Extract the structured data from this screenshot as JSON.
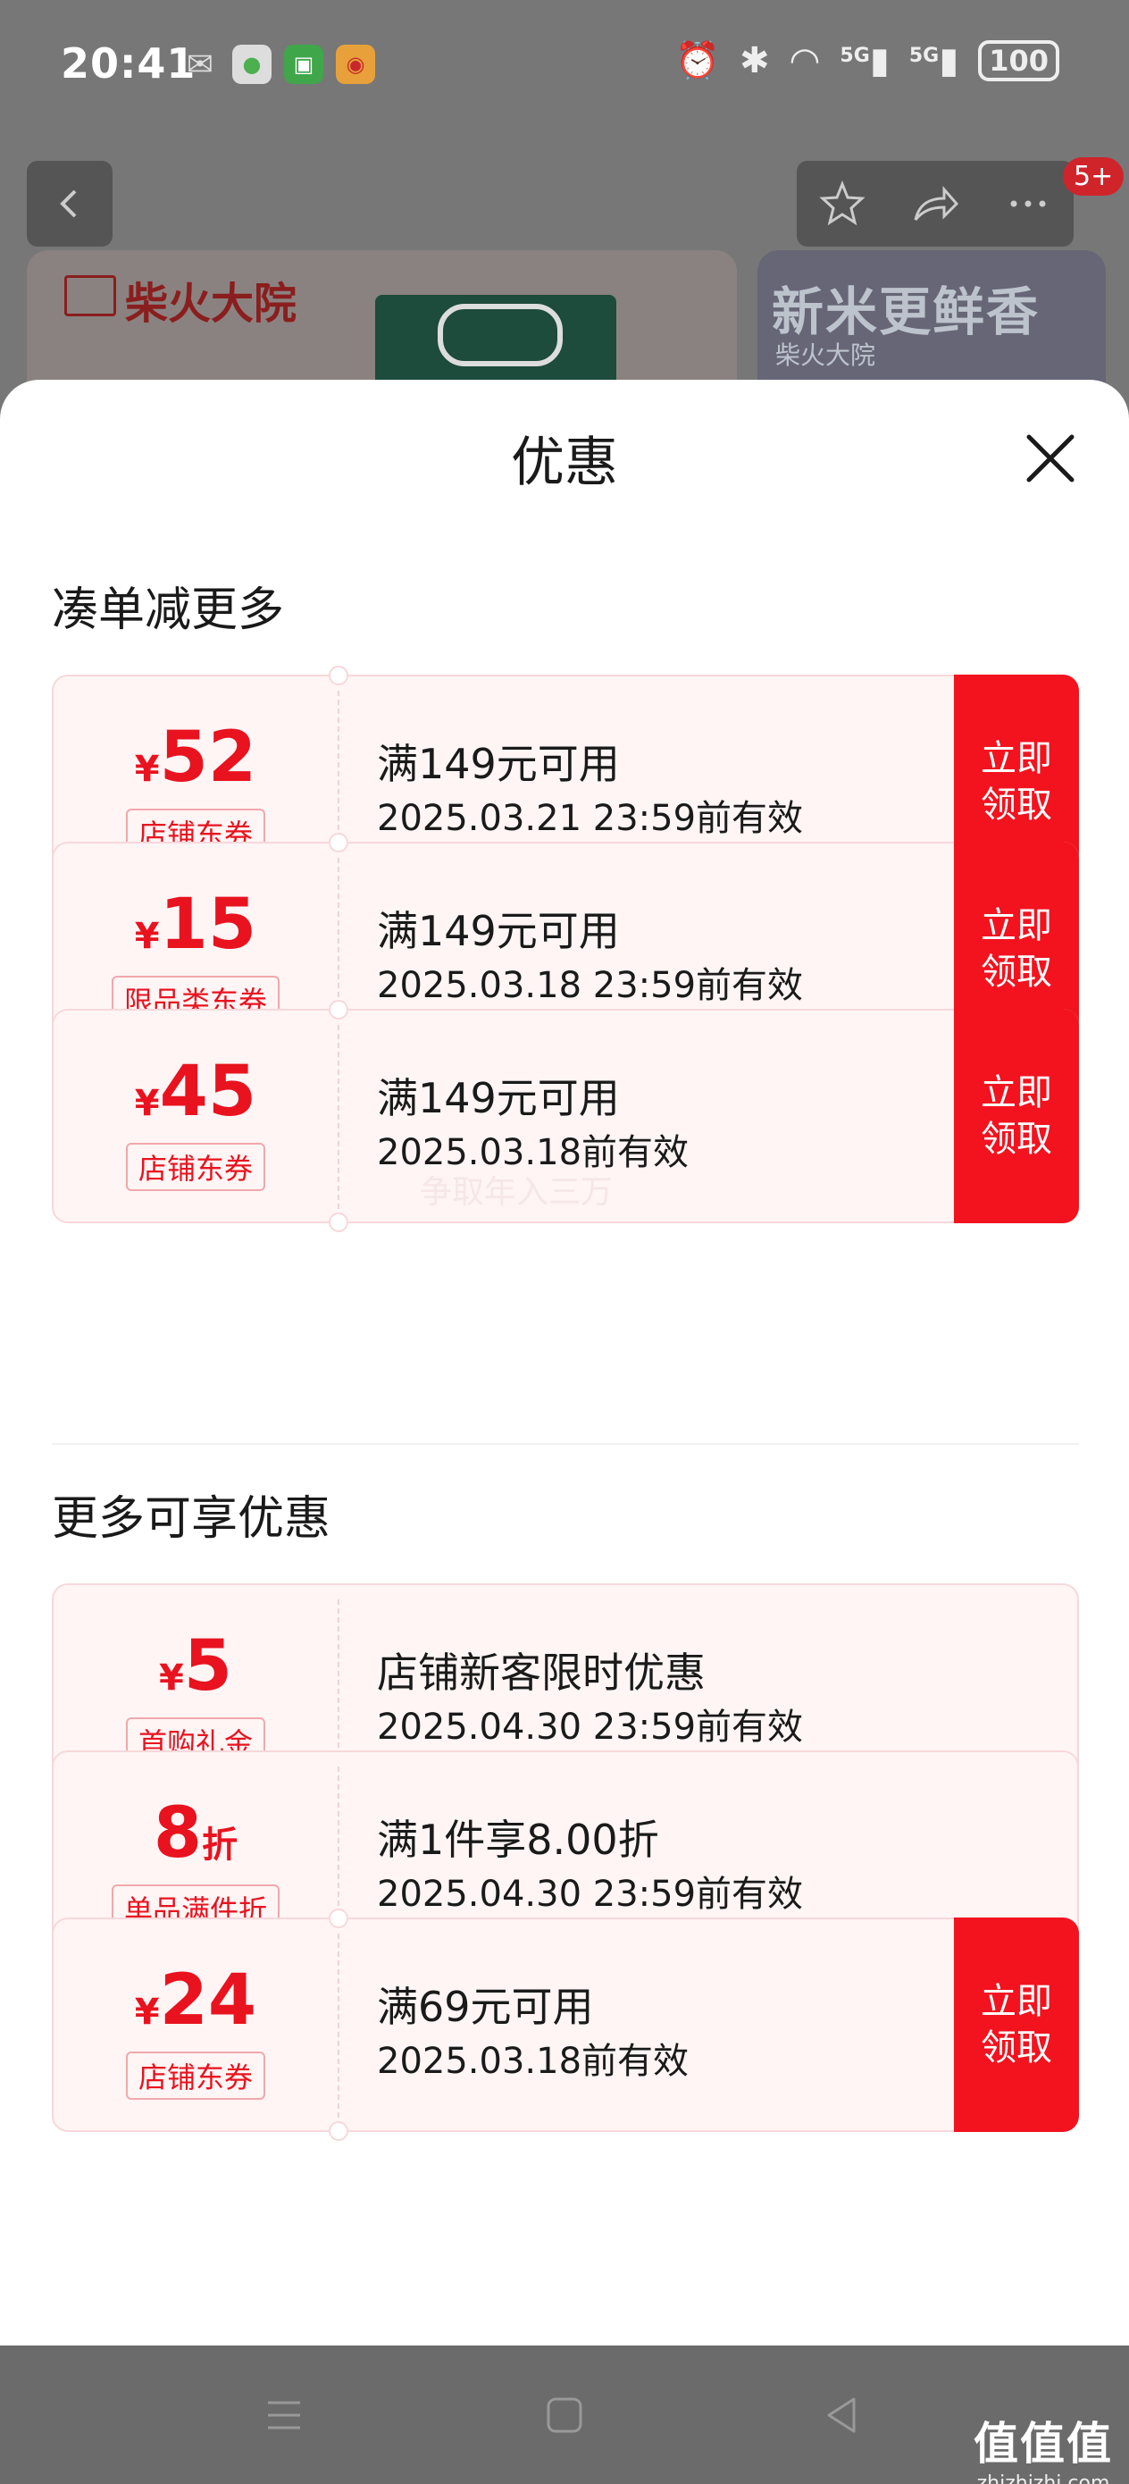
{
  "status_bar": {
    "time": "20:41",
    "battery": "100",
    "signal_1": "5G",
    "signal_2": "5G"
  },
  "background": {
    "brand_name": "柴火大院",
    "banner_slogan": "新米更鲜香",
    "banner_sub": "柴火大院",
    "cart_badge": "5+"
  },
  "sheet": {
    "title": "优惠"
  },
  "sections": [
    {
      "title": "凑单减更多"
    },
    {
      "title": "更多可享优惠"
    }
  ],
  "coupons": [
    {
      "currency": "¥",
      "amount": "52",
      "unit": "",
      "tag": "店铺东券",
      "condition": "满149元可用",
      "validity": "2025.03.21 23:59前有效",
      "claim_label": "立即领取",
      "claimable": true
    },
    {
      "currency": "¥",
      "amount": "15",
      "unit": "",
      "tag": "限品类东券",
      "condition": "满149元可用",
      "validity": "2025.03.18 23:59前有效",
      "claim_label": "立即领取",
      "claimable": true
    },
    {
      "currency": "¥",
      "amount": "45",
      "unit": "",
      "tag": "店铺东券",
      "condition": "满149元可用",
      "validity": "2025.03.18前有效",
      "claim_label": "立即领取",
      "claimable": true
    },
    {
      "currency": "¥",
      "amount": "5",
      "unit": "",
      "tag": "首购礼金",
      "condition": "店铺新客限时优惠",
      "validity": "2025.04.30 23:59前有效",
      "claim_label": "",
      "claimable": false
    },
    {
      "currency": "",
      "amount": "8",
      "unit": "折",
      "tag": "单品满件折",
      "condition": "满1件享8.00折",
      "validity": "2025.04.30 23:59前有效",
      "claim_label": "",
      "claimable": false
    },
    {
      "currency": "¥",
      "amount": "24",
      "unit": "",
      "tag": "店铺东券",
      "condition": "满69元可用",
      "validity": "2025.03.18前有效",
      "claim_label": "立即领取",
      "claimable": true
    }
  ],
  "watermark": "争取年入三万",
  "site_mark": {
    "big": "值值值",
    "small": "zhizhizhi.com"
  },
  "colors": {
    "accent": "#f2131f",
    "coupon_bg": "#fff5f5",
    "coupon_border": "#f7d8da"
  }
}
